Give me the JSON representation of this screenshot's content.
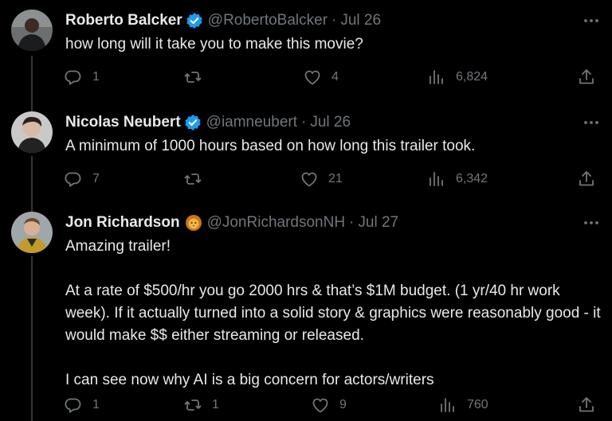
{
  "tweets": [
    {
      "name": "Roberto Balcker",
      "verified": true,
      "handle": "@RobertoBalcker",
      "sep": "·",
      "date": "Jul 26",
      "text": "how long will it take you to make this movie?",
      "replies": "1",
      "retweets": "",
      "likes": "4",
      "views": "6,824"
    },
    {
      "name": "Nicolas Neubert",
      "verified": true,
      "handle": "@iamneubert",
      "sep": "·",
      "date": "Jul 26",
      "text": "A minimum of 1000 hours based on how long this trailer took.",
      "replies": "7",
      "retweets": "",
      "likes": "21",
      "views": "6,342"
    },
    {
      "name": "Jon Richardson",
      "verified": false,
      "emoji": "lion-emoji",
      "handle": "@JonRichardsonNH",
      "sep": "·",
      "date": "Jul 27",
      "text": "Amazing trailer!\n\nAt a rate of $500/hr you go 2000 hrs & that’s $1M budget. (1 yr/40 hr work week). If it actually turned into a solid story & graphics were reasonably good - it would make $$ either streaming or released.\n\nI can see now why AI is a big concern for actors/writers",
      "replies": "1",
      "retweets": "1",
      "likes": "9",
      "views": "760"
    }
  ],
  "icons": {
    "verified": "verified-badge-icon",
    "more": "more-options-icon",
    "reply": "reply-icon",
    "retweet": "retweet-icon",
    "like": "like-icon",
    "views": "views-icon",
    "share": "share-icon"
  },
  "colors": {
    "background": "#000000",
    "text": "#e7e9ea",
    "secondary": "#71767b",
    "verified": "#1d9bf0",
    "thread_line": "#333639"
  }
}
